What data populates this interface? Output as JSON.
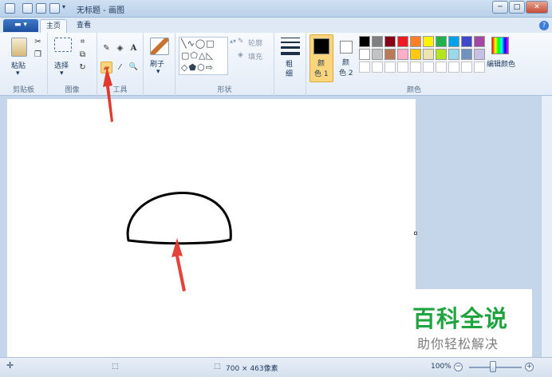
{
  "window": {
    "title": "无标题 - 画图",
    "minimize": "─",
    "maximize": "□",
    "close": "✕"
  },
  "menu": {
    "paint_button": "▬ ▾"
  },
  "tabs": [
    {
      "label": "主页"
    },
    {
      "label": "查看"
    }
  ],
  "help_label": "?",
  "ribbon": {
    "clipboard": {
      "paste": "粘贴",
      "group": "剪贴板"
    },
    "image": {
      "select": "选择",
      "group": "图像"
    },
    "tools": {
      "group": "工具",
      "text_tool": "A",
      "magnifier": "🔍",
      "pencil": "✎",
      "fill": "◈",
      "eraser": "▰",
      "picker": "⁄"
    },
    "brushes": {
      "label": "刷子"
    },
    "shapes": {
      "outline": "轮廓",
      "fill": "填充",
      "group": "形状"
    },
    "size": {
      "label": "粗细"
    },
    "colors": {
      "color1_line1": "颜",
      "color1_line2": "色 1",
      "color2_line1": "颜",
      "color2_line2": "色 2",
      "edit": "编辑颜色",
      "group": "颜色",
      "color1_value": "#000000",
      "color2_value": "#ffffff",
      "palette_row1": [
        "#000000",
        "#7f7f7f",
        "#880015",
        "#ed1c24",
        "#ff7f27",
        "#fff200",
        "#22b14c",
        "#00a2e8",
        "#3f48cc",
        "#a349a4"
      ],
      "palette_row2": [
        "#ffffff",
        "#c3c3c3",
        "#b97a57",
        "#ffaec9",
        "#ffc90e",
        "#efe4b0",
        "#b5e61d",
        "#99d9ea",
        "#7092be",
        "#c8bfe7"
      ]
    }
  },
  "status": {
    "image_size": "700 × 463像素",
    "zoom": "100%",
    "zoom_out": "−",
    "zoom_in": "+"
  },
  "watermark": {
    "title": "百科全说",
    "subtitle": "助你轻松解决"
  },
  "accent": {
    "arrow": "#e03a2f",
    "selected_tool": "#fbd57c"
  }
}
